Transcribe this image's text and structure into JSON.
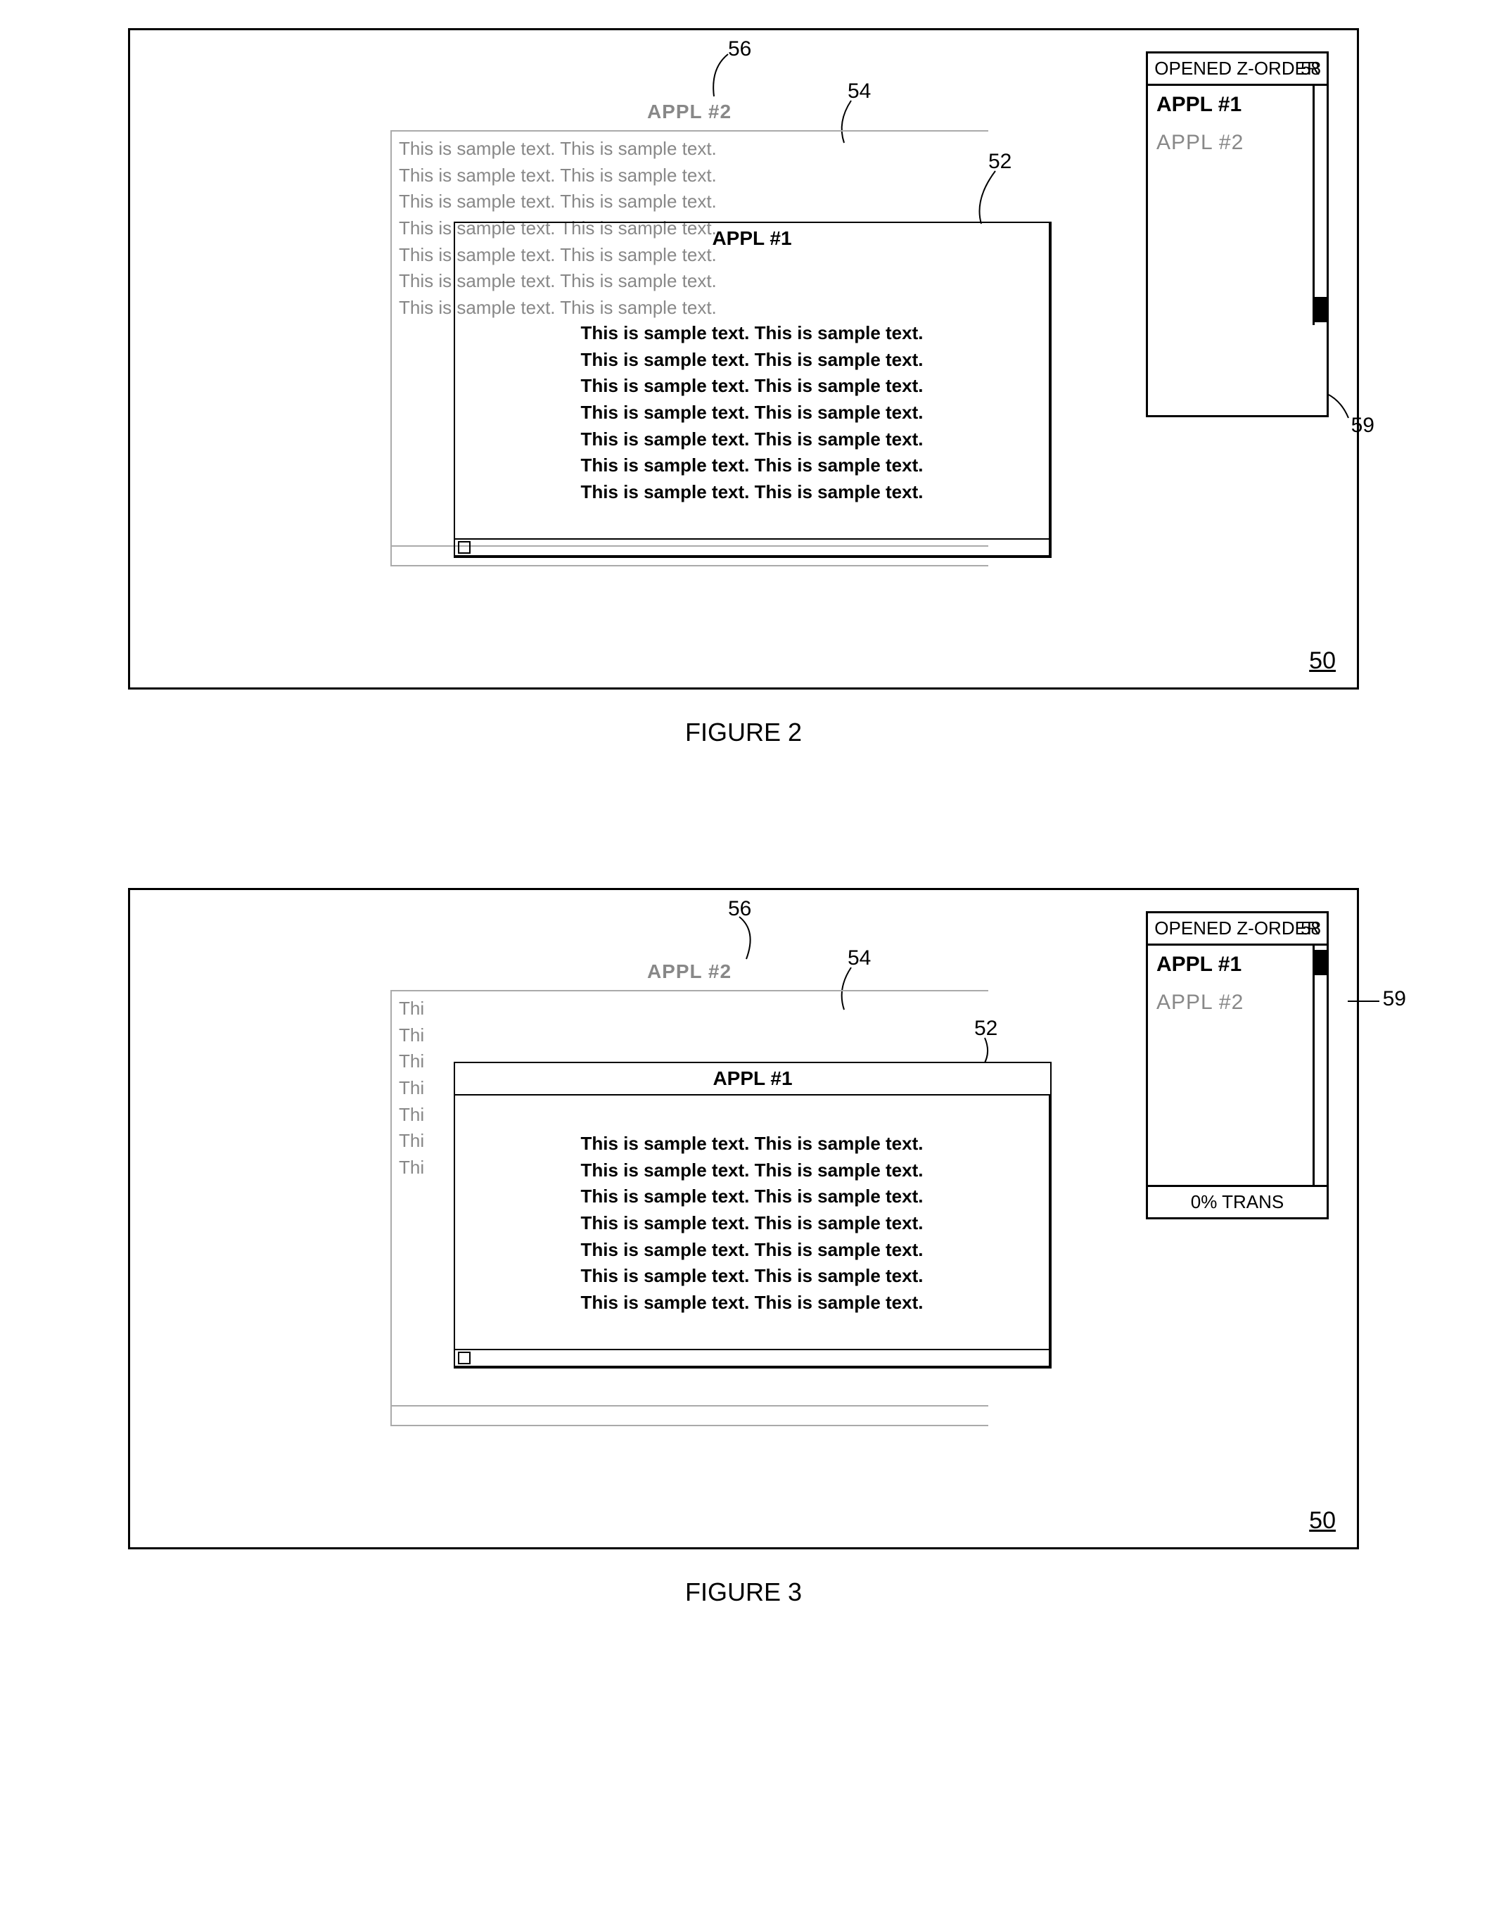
{
  "figures": {
    "fig2": {
      "caption": "FIGURE 2"
    },
    "fig3": {
      "caption": "FIGURE 3"
    }
  },
  "screen_id": "50",
  "refs": {
    "r52": "52",
    "r54": "54",
    "r56": "56",
    "r58": "58",
    "r59": "59"
  },
  "appl2": {
    "title": "APPL #2",
    "sample_line": "This is sample text.  This is sample text.",
    "sample_peek": "Thi"
  },
  "appl1": {
    "title": "APPL #1",
    "sample_line": "This is sample text.  This is sample text."
  },
  "zorder": {
    "header": "OPENED Z-ORDER",
    "items": [
      {
        "label": "APPL #1",
        "active": true
      },
      {
        "label": "APPL #2",
        "active": false
      }
    ],
    "footer_fig3": "0% TRANS"
  }
}
